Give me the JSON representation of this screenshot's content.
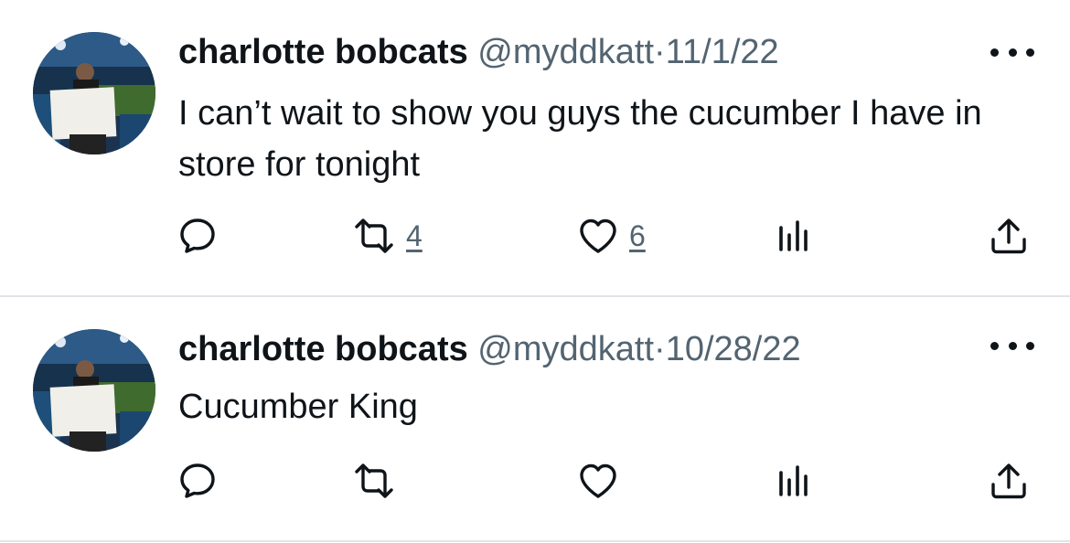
{
  "tweets": [
    {
      "name": "charlotte bobcats",
      "handle": "@myddkatt",
      "separator": "·",
      "date": "11/1/22",
      "text": "I can’t wait to show you guys the cucumber I have in store for tonight",
      "retweet_count": "4",
      "like_count": "6"
    },
    {
      "name": "charlotte bobcats",
      "handle": "@myddkatt",
      "separator": "·",
      "date": "10/28/22",
      "text": "Cucumber King",
      "retweet_count": "",
      "like_count": ""
    }
  ],
  "icons": {
    "reply": "speech-bubble-icon",
    "retweet": "retweet-arrows-icon",
    "like": "heart-icon",
    "views": "bar-chart-icon",
    "share": "share-upload-icon",
    "more": "three-dots-icon"
  },
  "colors": {
    "text": "#0f1419",
    "secondary": "#536471",
    "divider": "#e1e4e8"
  }
}
